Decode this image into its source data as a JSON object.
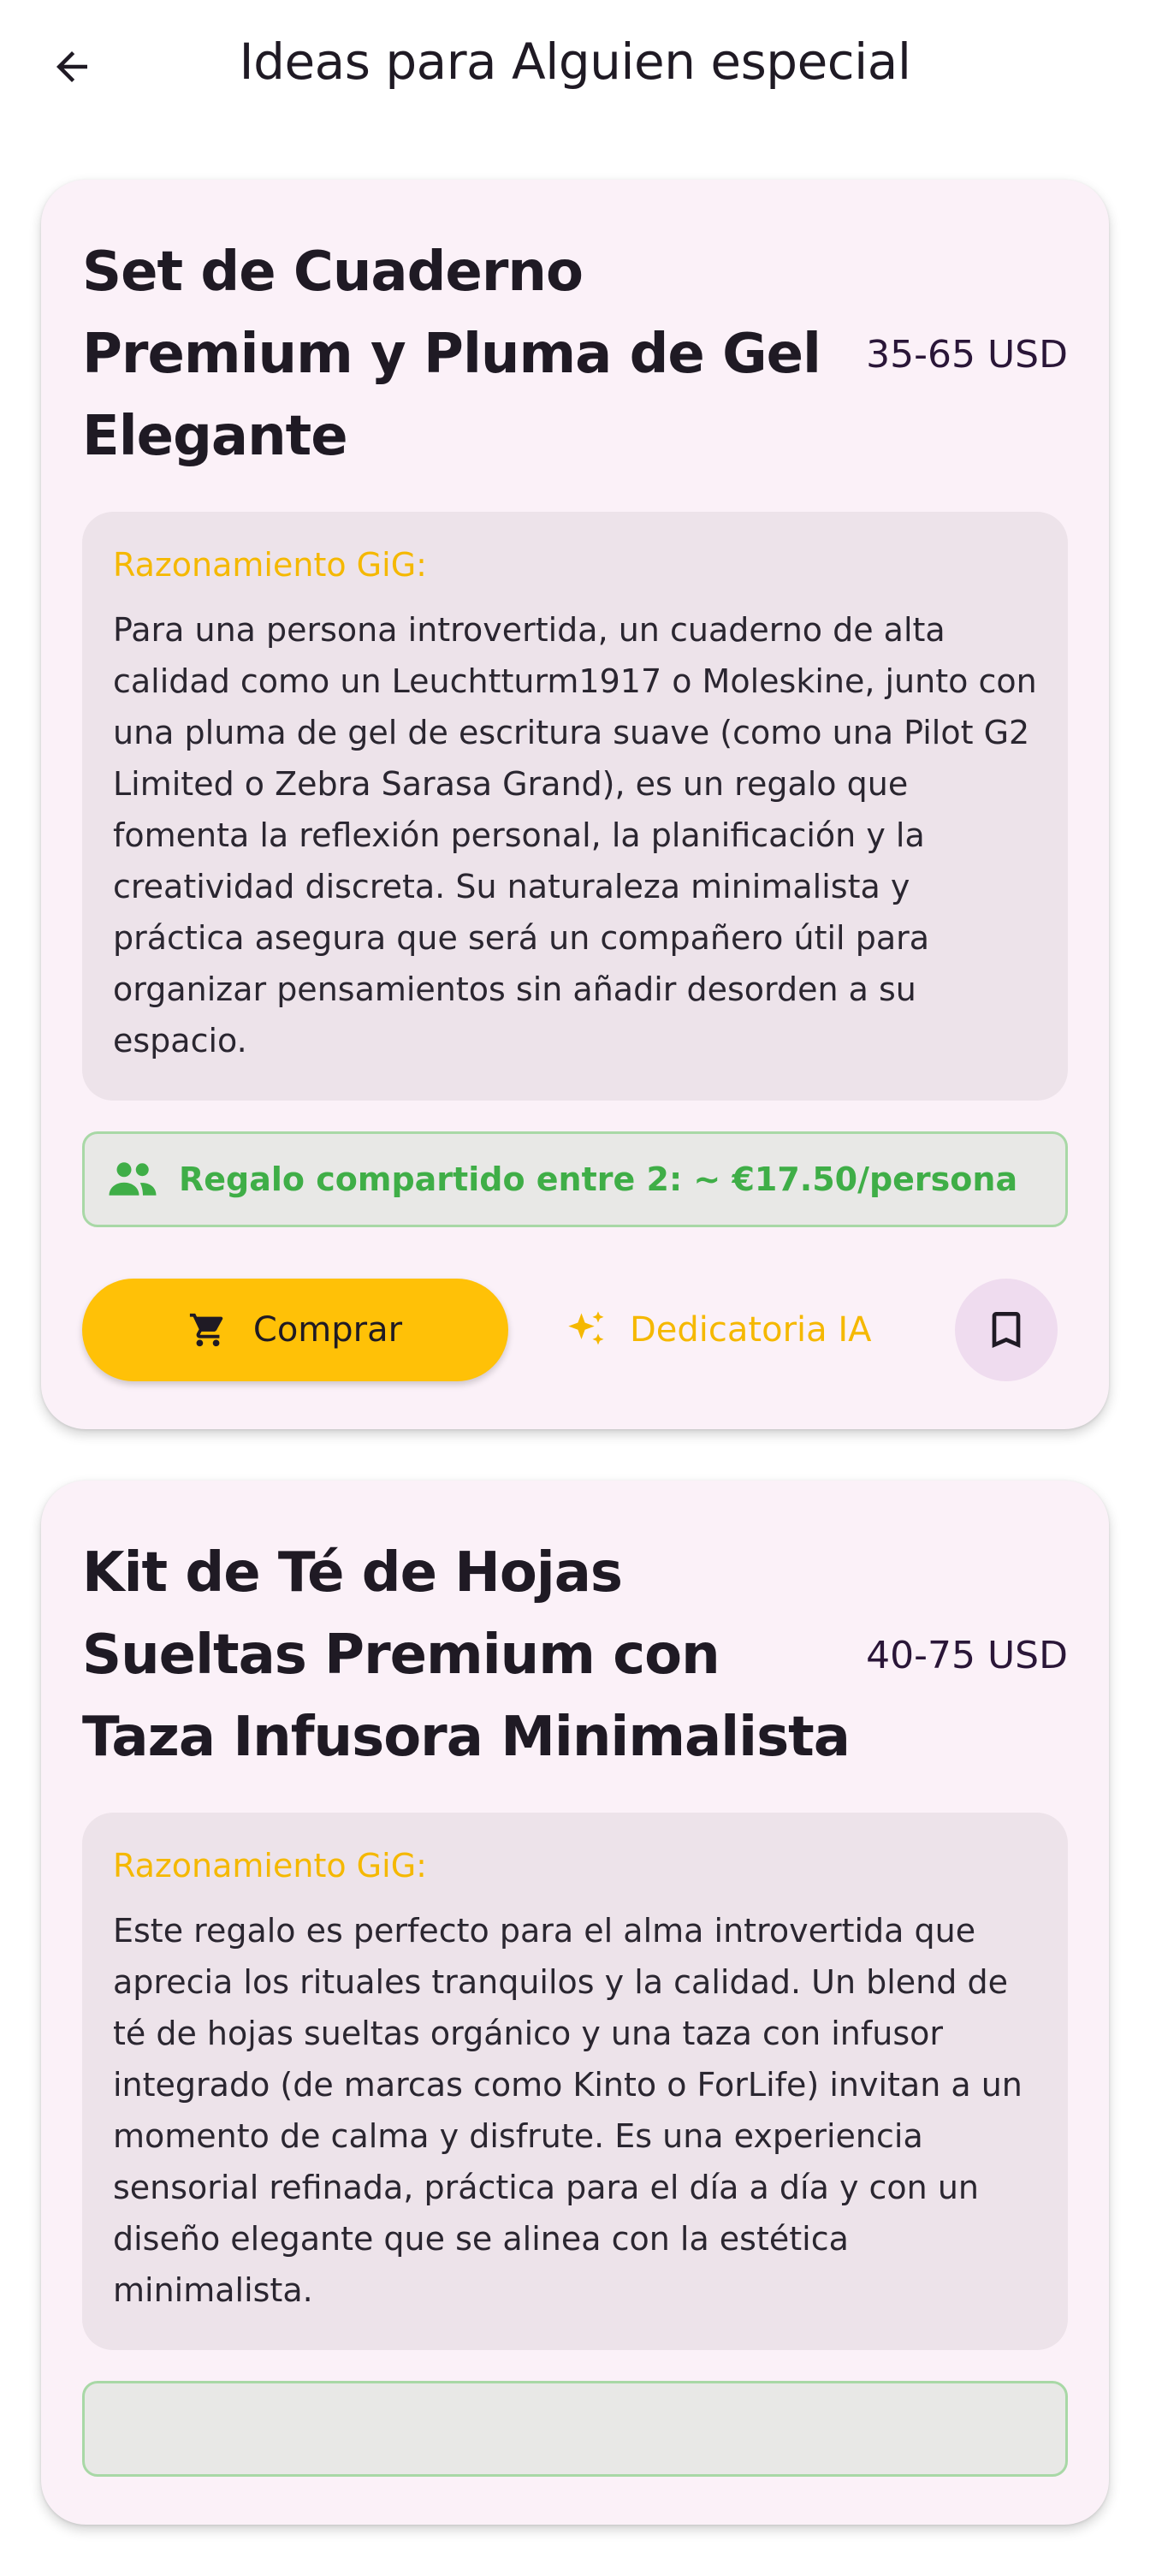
{
  "header": {
    "title": "Ideas para Alguien especial",
    "back_icon": "arrow-left-icon"
  },
  "colors": {
    "accent": "#ffc107",
    "card_bg": "#fbf1f8",
    "reason_bg": "#ede3ea",
    "shared_green": "#3fae47"
  },
  "cards": [
    {
      "title": "Set de Cuaderno Premium y Pluma de Gel Elegante",
      "price": "35-65 USD",
      "reason_label": "Razonamiento GiG:",
      "reason_text": "Para una persona introvertida, un cuaderno de alta calidad como un Leuchtturm1917 o Moleskine, junto con una pluma de gel de escritura suave (como una Pilot G2 Limited o Zebra Sarasa Grand), es un regalo que fomenta la reflexión personal, la planificación y la creatividad discreta. Su naturaleza minimalista y práctica asegura que será un compañero útil para organizar pensamientos sin añadir desorden a su espacio.",
      "shared_text": "Regalo compartido entre 2: ~ €17.50/persona",
      "buy_label": "Comprar",
      "ai_label": "Dedicatoria IA"
    },
    {
      "title": "Kit de Té de Hojas Sueltas Premium con Taza Infusora Minimalista",
      "price": "40-75 USD",
      "reason_label": "Razonamiento GiG:",
      "reason_text": "Este regalo es perfecto para el alma introvertida que aprecia los rituales tranquilos y la calidad. Un blend de té de hojas sueltas orgánico y una taza con infusor integrado (de marcas como Kinto o ForLife) invitan a un momento de calma y disfrute. Es una experiencia sensorial refinada, práctica para el día a día y con un diseño elegante que se alinea con la estética minimalista."
    }
  ]
}
